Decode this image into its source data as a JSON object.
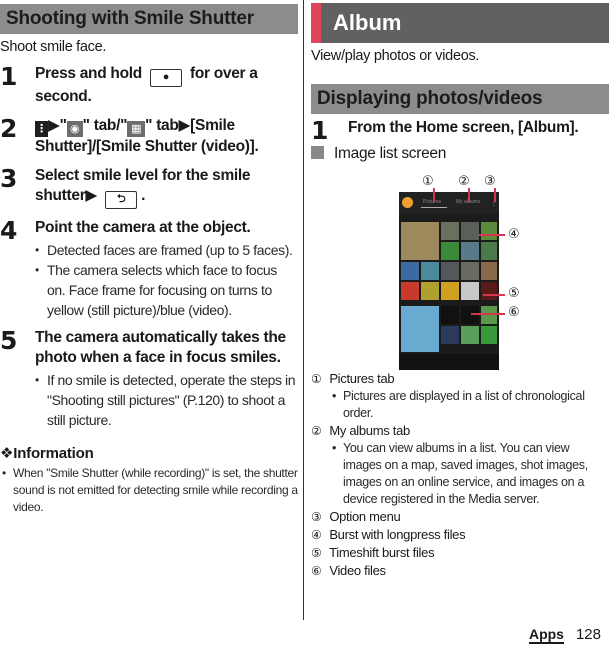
{
  "left": {
    "heading": "Shooting with Smile Shutter",
    "intro": "Shoot smile face.",
    "steps": [
      {
        "num": "1",
        "title_a": "Press and hold",
        "title_b": "for over a second.",
        "key_icon": "camera-key-icon"
      },
      {
        "num": "2",
        "parts": [
          "▶\"",
          "\" tab/\"",
          "\" tab▶[Smile Shutter]/[Smile Shutter (video)]."
        ],
        "icons": [
          "menu-icon",
          "camera-mode-icon",
          "video-mode-icon"
        ]
      },
      {
        "num": "3",
        "title": "Select smile level for the smile shutter▶",
        "end": ".",
        "key_icon": "back-key-icon"
      },
      {
        "num": "4",
        "title": "Point the camera at the object.",
        "bullets": [
          "Detected faces are framed (up to 5 faces).",
          "The camera selects which face to focus on. Face frame for focusing on turns to yellow (still picture)/blue (video)."
        ]
      },
      {
        "num": "5",
        "title": "The camera automatically takes the photo when a face in focus smiles.",
        "bullets": [
          "If no smile is detected, operate the steps in \"Shooting still pictures\" (P.120) to shoot a still picture."
        ]
      }
    ],
    "information": {
      "title": "❖Information",
      "items": [
        "When \"Smile Shutter (while recording)\" is set, the shutter sound is not emitted for detecting smile while recording a video."
      ]
    }
  },
  "right": {
    "heading": "Album",
    "accent_color": "#e0465a",
    "intro": "View/play photos or videos.",
    "subheading": "Displaying photos/videos",
    "step": {
      "num": "1",
      "title": "From the Home screen, [Album]."
    },
    "screen_label": "Image list screen",
    "callouts": [
      "①",
      "②",
      "③",
      "④",
      "⑤",
      "⑥"
    ],
    "screenshot_tabs": [
      "Pictures",
      "My albums"
    ],
    "legend": [
      {
        "mark": "①",
        "label": "Pictures tab",
        "bullets": [
          "Pictures are displayed in a list of chronological order."
        ]
      },
      {
        "mark": "②",
        "label": "My albums tab",
        "bullets": [
          "You can view albums in a list. You can view images on a map, saved images, shot images, images on an online service, and images on a device registered in the Media server."
        ]
      },
      {
        "mark": "③",
        "label": "Option menu",
        "bullets": []
      },
      {
        "mark": "④",
        "label": "Burst with longpress files",
        "bullets": []
      },
      {
        "mark": "⑤",
        "label": "Timeshift burst files",
        "bullets": []
      },
      {
        "mark": "⑥",
        "label": "Video files",
        "bullets": []
      }
    ]
  },
  "footer": {
    "section": "Apps",
    "page": "128"
  }
}
